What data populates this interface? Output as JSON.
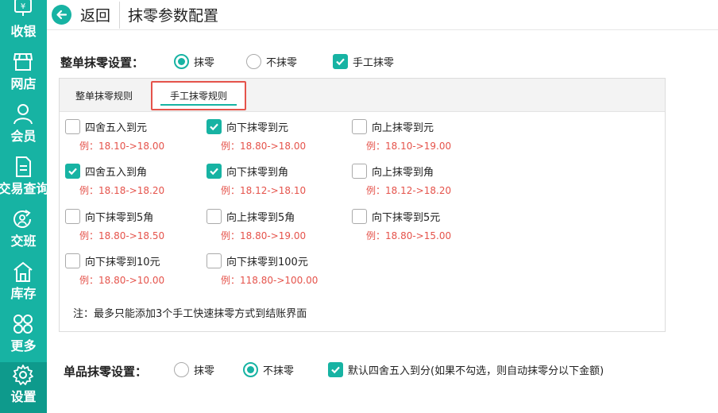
{
  "sidebar": {
    "items": [
      {
        "label": "收银",
        "icon": "yen-icon"
      },
      {
        "label": "网店",
        "icon": "shop-icon"
      },
      {
        "label": "会员",
        "icon": "user-icon"
      },
      {
        "label": "交易查询",
        "icon": "document-icon"
      },
      {
        "label": "交班",
        "icon": "shift-icon"
      },
      {
        "label": "库存",
        "icon": "warehouse-icon"
      },
      {
        "label": "更多",
        "icon": "more-icon"
      },
      {
        "label": "设置",
        "icon": "gear-icon"
      }
    ],
    "active": "设置"
  },
  "header": {
    "back_label": "返回",
    "title": "抹零参数配置"
  },
  "whole_order": {
    "label": "整单抹零设置：",
    "options": [
      {
        "label": "抹零",
        "type": "radio",
        "checked": true
      },
      {
        "label": "不抹零",
        "type": "radio",
        "checked": false
      },
      {
        "label": "手工抹零",
        "type": "checkbox",
        "checked": true
      }
    ]
  },
  "tabs": [
    {
      "label": "整单抹零规则",
      "active": false
    },
    {
      "label": "手工抹零规则",
      "active": true
    }
  ],
  "rules": [
    {
      "label": "四舍五入到元",
      "example": "例：18.10->18.00",
      "checked": false
    },
    {
      "label": "向下抹零到元",
      "example": "例：18.80->18.00",
      "checked": true
    },
    {
      "label": "向上抹零到元",
      "example": "例：18.10->19.00",
      "checked": false
    },
    {
      "label": "四舍五入到角",
      "example": "例：18.18->18.20",
      "checked": true
    },
    {
      "label": "向下抹零到角",
      "example": "例：18.12->18.10",
      "checked": true
    },
    {
      "label": "向上抹零到角",
      "example": "例：18.12->18.20",
      "checked": false
    },
    {
      "label": "向下抹零到5角",
      "example": "例：18.80->18.50",
      "checked": false
    },
    {
      "label": "向上抹零到5角",
      "example": "例：18.80->19.00",
      "checked": false
    },
    {
      "label": "向下抹零到5元",
      "example": "例：18.80->15.00",
      "checked": false
    },
    {
      "label": "向下抹零到10元",
      "example": "例：18.80->10.00",
      "checked": false
    },
    {
      "label": "向下抹零到100元",
      "example": "例：118.80->100.00",
      "checked": false
    }
  ],
  "note": "注：最多只能添加3个手工快速抹零方式到结账界面",
  "single_item": {
    "label": "单品抹零设置：",
    "options": [
      {
        "label": "抹零",
        "type": "radio",
        "checked": false
      },
      {
        "label": "不抹零",
        "type": "radio",
        "checked": true
      },
      {
        "label": "默认四舍五入到分(如果不勾选，则自动抹零分以下金额)",
        "type": "checkbox",
        "checked": true
      }
    ]
  },
  "colors": {
    "accent": "#17b3a3",
    "example_text": "#e5534b",
    "tab_highlight_border": "#e5534b"
  }
}
